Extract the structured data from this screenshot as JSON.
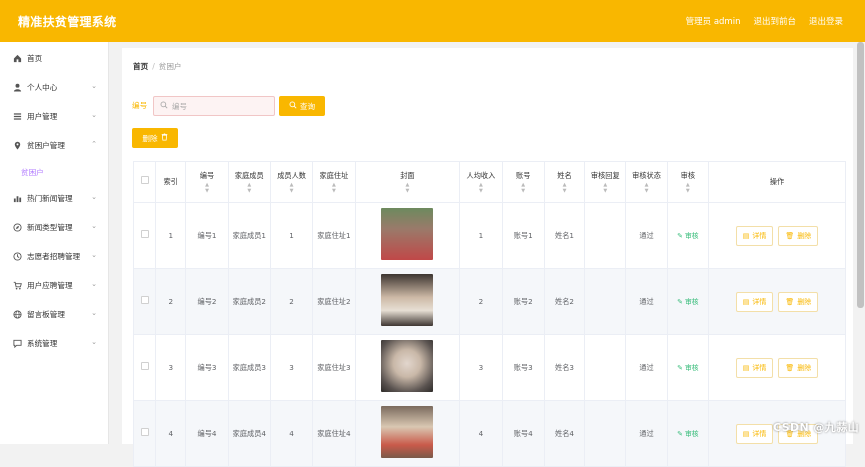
{
  "header": {
    "brand": "精准扶贫管理系统",
    "user": "管理员 admin",
    "back_to_front": "退出到前台",
    "logout": "退出登录"
  },
  "sidebar": {
    "items": [
      {
        "label": "首页",
        "icon": "home-icon",
        "chevron": false
      },
      {
        "label": "个人中心",
        "icon": "user-icon",
        "chevron": true
      },
      {
        "label": "用户管理",
        "icon": "list-icon",
        "chevron": true
      },
      {
        "label": "贫困户管理",
        "icon": "location-icon",
        "chevron": true
      },
      {
        "label": "热门新闻管理",
        "icon": "chart-icon",
        "chevron": true
      },
      {
        "label": "新闻类型管理",
        "icon": "compass-icon",
        "chevron": true
      },
      {
        "label": "志愿者招聘管理",
        "icon": "clock-icon",
        "chevron": true
      },
      {
        "label": "用户应聘管理",
        "icon": "cart-icon",
        "chevron": true
      },
      {
        "label": "留言板管理",
        "icon": "globe-icon",
        "chevron": true
      },
      {
        "label": "系统管理",
        "icon": "chat-icon",
        "chevron": true
      }
    ],
    "submenu": "贫困户"
  },
  "breadcrumb": {
    "home": "首页",
    "sep": "/",
    "current": "贫困户"
  },
  "search": {
    "label": "编号",
    "placeholder": "编号",
    "button": "查询"
  },
  "toolbar": {
    "delete_label": "删除"
  },
  "table": {
    "headers": [
      "索引",
      "编号",
      "家庭成员",
      "成员人数",
      "家庭住址",
      "封面",
      "人均收入",
      "账号",
      "姓名",
      "审核回复",
      "审核状态",
      "审核",
      "操作"
    ],
    "rows": [
      {
        "index": "1",
        "code": "编号1",
        "member": "家庭成员1",
        "count": "1",
        "address": "家庭住址1",
        "income": "1",
        "account": "账号1",
        "name": "姓名1",
        "reply": "",
        "status": "通过",
        "audit": "审核",
        "detail": "详情",
        "delete": "删除"
      },
      {
        "index": "2",
        "code": "编号2",
        "member": "家庭成员2",
        "count": "2",
        "address": "家庭住址2",
        "income": "2",
        "account": "账号2",
        "name": "姓名2",
        "reply": "",
        "status": "通过",
        "audit": "审核",
        "detail": "详情",
        "delete": "删除"
      },
      {
        "index": "3",
        "code": "编号3",
        "member": "家庭成员3",
        "count": "3",
        "address": "家庭住址3",
        "income": "3",
        "account": "账号3",
        "name": "姓名3",
        "reply": "",
        "status": "通过",
        "audit": "审核",
        "detail": "详情",
        "delete": "删除"
      },
      {
        "index": "4",
        "code": "编号4",
        "member": "家庭成员4",
        "count": "4",
        "address": "家庭住址4",
        "income": "4",
        "account": "账号4",
        "name": "姓名4",
        "reply": "",
        "status": "通过",
        "audit": "审核",
        "detail": "详情",
        "delete": "删除"
      }
    ]
  },
  "watermark": "CSDN @九蒜山",
  "colors": {
    "accent": "#f9b700",
    "submenu": "#b27bff",
    "audit": "#33bb77"
  }
}
